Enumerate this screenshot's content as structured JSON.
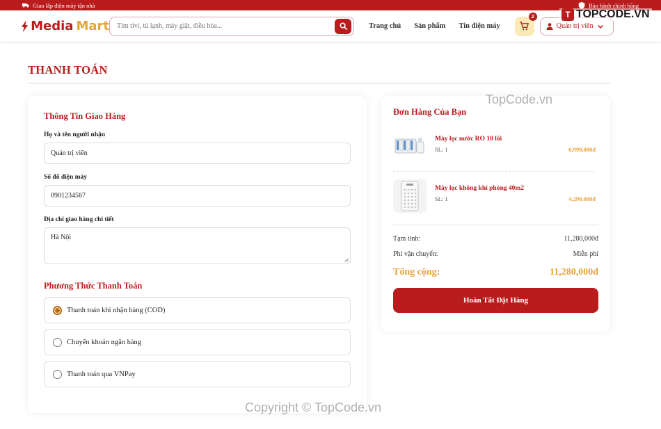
{
  "topbar": {
    "left_text": "Giao lắp điện máy tận nhà",
    "right_text": "Bảo hành chính hãng"
  },
  "header": {
    "logo_part1": "Media",
    "logo_part2": "Mart",
    "search_placeholder": "Tìm tivi, tủ lạnh, máy giặt, điều hòa...",
    "nav": [
      "Trang chủ",
      "Sản phẩm",
      "Tin điện máy"
    ],
    "cart_count": "2",
    "user_label": "Quản trị viên"
  },
  "page": {
    "title": "THANH TOÁN"
  },
  "shipping": {
    "title": "Thông Tin Giao Hàng",
    "name_label": "Họ và tên người nhận",
    "name_value": "Quản trị viên",
    "phone_label": "Số đổ điện máy",
    "phone_value": "0901234567",
    "address_label": "Địa chỉ giao hàng chi tiết",
    "address_value": "Hà Nội"
  },
  "payment": {
    "title": "Phương Thức Thanh Toán",
    "options": [
      {
        "label": "Thanh toán khi nhận hàng (COD)",
        "selected": true
      },
      {
        "label": "Chuyển khoản ngân hàng",
        "selected": false
      },
      {
        "label": "Thanh toán qua VNPay",
        "selected": false
      }
    ]
  },
  "order": {
    "title": "Đơn Hàng Của Bạn",
    "items": [
      {
        "name": "Máy lọc nước RO 10 lõi",
        "qty": "SL: 1",
        "price": "6,990,000đ",
        "icon": "water-purifier-icon"
      },
      {
        "name": "Máy lọc không khí phòng 40m2",
        "qty": "SL: 1",
        "price": "4,290,000đ",
        "icon": "air-purifier-icon"
      }
    ],
    "subtotal_label": "Tạm tính:",
    "subtotal_value": "11,280,000đ",
    "shipping_label": "Phí vận chuyển:",
    "shipping_value": "Miễn phí",
    "total_label": "Tổng cộng:",
    "total_value": "11,280,000đ",
    "submit_label": "Hoàn Tất Đặt Hàng"
  },
  "watermark": {
    "logo_letter": "T",
    "logo_text": "TOPCODE.VN",
    "text_top": "TopCode.vn",
    "text_bottom": "Copyright © TopCode.vn"
  },
  "colors": {
    "brand": "#b91c1c",
    "accent": "#e8a33b"
  }
}
